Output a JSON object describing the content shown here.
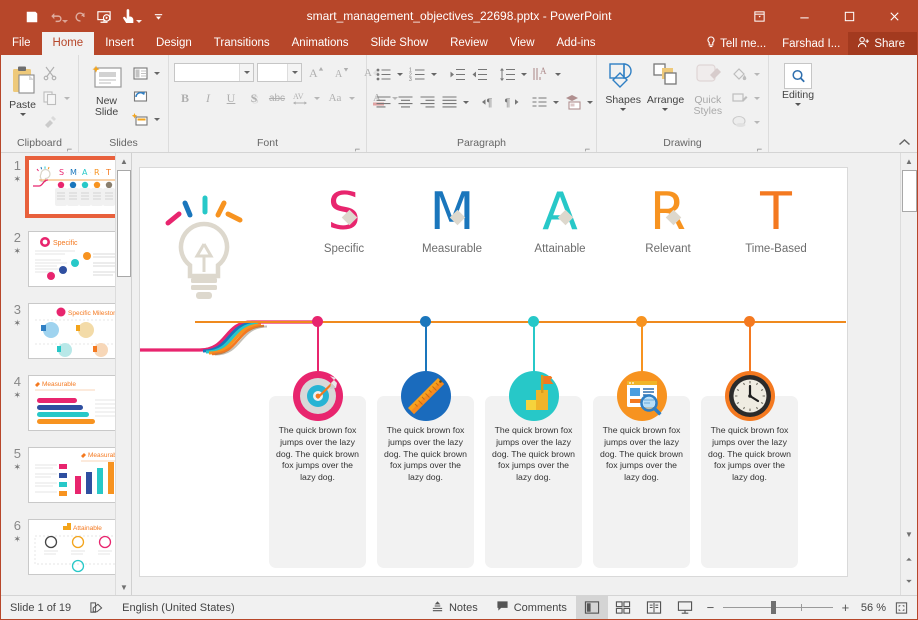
{
  "window": {
    "title": "smart_management_objectives_22698.pptx - PowerPoint",
    "quick_access": [
      {
        "name": "save",
        "icon": "save-icon"
      },
      {
        "name": "undo",
        "icon": "undo-icon"
      },
      {
        "name": "redo",
        "icon": "redo-icon"
      },
      {
        "name": "start-from-beginning",
        "icon": "slideshow-icon"
      },
      {
        "name": "touch-mouse-mode",
        "icon": "touch-mode-icon"
      },
      {
        "name": "customize-quick-access-toolbar",
        "icon": "chevron-down-icon"
      }
    ],
    "controls": {
      "restore": "restore-icon",
      "minimize": "minimize-icon",
      "maximize": "maximize-icon",
      "close": "close-icon"
    }
  },
  "ribbon": {
    "tabs": [
      {
        "label": "File",
        "active": false
      },
      {
        "label": "Home",
        "active": true
      },
      {
        "label": "Insert",
        "active": false
      },
      {
        "label": "Design",
        "active": false
      },
      {
        "label": "Transitions",
        "active": false
      },
      {
        "label": "Animations",
        "active": false
      },
      {
        "label": "Slide Show",
        "active": false
      },
      {
        "label": "Review",
        "active": false
      },
      {
        "label": "View",
        "active": false
      },
      {
        "label": "Add-ins",
        "active": false
      }
    ],
    "tell_me": "Tell me...",
    "user_name": "Farshad I...",
    "share_label": "Share",
    "groups": [
      {
        "label": "Clipboard",
        "items": [
          {
            "label": "Paste",
            "icon": "paste-icon"
          },
          {
            "label": "Cut",
            "icon": "scissors-icon"
          },
          {
            "label": "Copy",
            "icon": "copy-icon"
          },
          {
            "label": "Format Painter",
            "icon": "format-painter-icon"
          }
        ]
      },
      {
        "label": "Slides",
        "items": [
          {
            "label": "New Slide",
            "icon": "new-slide-icon"
          },
          {
            "label": "Layout",
            "icon": "layout-icon"
          },
          {
            "label": "Reset",
            "icon": "reset-icon"
          },
          {
            "label": "Section",
            "icon": "section-icon"
          }
        ]
      },
      {
        "label": "Font",
        "items": [
          {
            "label": "Bold",
            "icon": "bold-icon"
          },
          {
            "label": "Italic",
            "icon": "italic-icon"
          },
          {
            "label": "Underline",
            "icon": "underline-icon"
          },
          {
            "label": "Text Shadow",
            "icon": "text-shadow-icon"
          },
          {
            "label": "Strikethrough",
            "icon": "strikethrough-icon"
          },
          {
            "label": "Character Spacing",
            "icon": "character-spacing-icon"
          },
          {
            "label": "Change Case",
            "icon": "change-case-icon"
          },
          {
            "label": "Font Color",
            "icon": "font-color-icon"
          },
          {
            "label": "Increase Font Size",
            "icon": "increase-font-icon"
          },
          {
            "label": "Decrease Font Size",
            "icon": "decrease-font-icon"
          },
          {
            "label": "Clear Formatting",
            "icon": "clear-formatting-icon"
          }
        ],
        "font_name": "",
        "font_name_placeholder": "",
        "font_size": "",
        "font_size_placeholder": ""
      },
      {
        "label": "Paragraph",
        "items": [
          {
            "label": "Bullets",
            "icon": "bullets-icon"
          },
          {
            "label": "Numbering",
            "icon": "numbering-icon"
          },
          {
            "label": "Decrease Indent",
            "icon": "decrease-indent-icon"
          },
          {
            "label": "Increase Indent",
            "icon": "increase-indent-icon"
          },
          {
            "label": "Line Spacing",
            "icon": "line-spacing-icon"
          },
          {
            "label": "Align Left",
            "icon": "align-left-icon"
          },
          {
            "label": "Center",
            "icon": "align-center-icon"
          },
          {
            "label": "Align Right",
            "icon": "align-right-icon"
          },
          {
            "label": "Justify",
            "icon": "justify-icon"
          },
          {
            "label": "Text Direction",
            "icon": "text-direction-icon"
          },
          {
            "label": "Align Text",
            "icon": "align-text-icon"
          },
          {
            "label": "Convert to SmartArt",
            "icon": "smartart-icon"
          }
        ]
      },
      {
        "label": "Drawing",
        "items": [
          {
            "label": "Shapes",
            "icon": "shapes-icon"
          },
          {
            "label": "Arrange",
            "icon": "arrange-icon"
          },
          {
            "label": "Quick Styles",
            "icon": "quick-styles-icon"
          },
          {
            "label": "Shape Fill",
            "icon": "shape-fill-icon"
          },
          {
            "label": "Shape Outline",
            "icon": "shape-outline-icon"
          },
          {
            "label": "Shape Effects",
            "icon": "shape-effects-icon"
          }
        ]
      },
      {
        "label": "",
        "items": [
          {
            "label": "Editing",
            "icon": "find-icon"
          }
        ]
      }
    ],
    "collapse_icon": "chevron-up-icon"
  },
  "thumbnails": [
    {
      "number": "1",
      "selected": true
    },
    {
      "number": "2",
      "selected": false
    },
    {
      "number": "3",
      "selected": false
    },
    {
      "number": "4",
      "selected": false
    },
    {
      "number": "5",
      "selected": false
    },
    {
      "number": "6",
      "selected": false
    }
  ],
  "slide": {
    "timeline_color": "#ef8a1e",
    "lamp_icon": "lightbulb-icon",
    "body_text_a": "The quick brown fox jumps over the lazy dog. The quick brown fox jumps over the lazy dog.",
    "items": [
      {
        "letter": "S",
        "label": "Specific",
        "color": "#e8256e",
        "icon": "target-dartboard-icon"
      },
      {
        "letter": "M",
        "label": "Measurable",
        "color": "#1a76bc",
        "icon": "ruler-icon"
      },
      {
        "letter": "A",
        "label": "Attainable",
        "color": "#27c8c8",
        "icon": "stairs-flag-icon"
      },
      {
        "letter": "R",
        "label": "Relevant",
        "color": "#f79320",
        "icon": "webpage-search-icon"
      },
      {
        "letter": "T",
        "label": "Time-Based",
        "color": "#f47920",
        "icon": "clock-icon"
      }
    ]
  },
  "status_bar": {
    "slide_counter": "Slide 1 of 19",
    "spelling_icon": "spell-check-icon",
    "language": "English (United States)",
    "notes_label": "Notes",
    "notes_icon": "notes-icon",
    "comments_label": "Comments",
    "comments_icon": "comment-icon",
    "views": [
      {
        "name": "normal-view",
        "icon": "normal-view-icon",
        "active": true
      },
      {
        "name": "slide-sorter-view",
        "icon": "slide-sorter-icon",
        "active": false
      },
      {
        "name": "reading-view",
        "icon": "reading-view-icon",
        "active": false
      },
      {
        "name": "slide-show-view",
        "icon": "slideshow-view-icon",
        "active": false
      }
    ],
    "zoom_out": "−",
    "zoom_in": "+",
    "zoom_level": "56 %",
    "fit_slide_icon": "fit-to-window-icon"
  }
}
